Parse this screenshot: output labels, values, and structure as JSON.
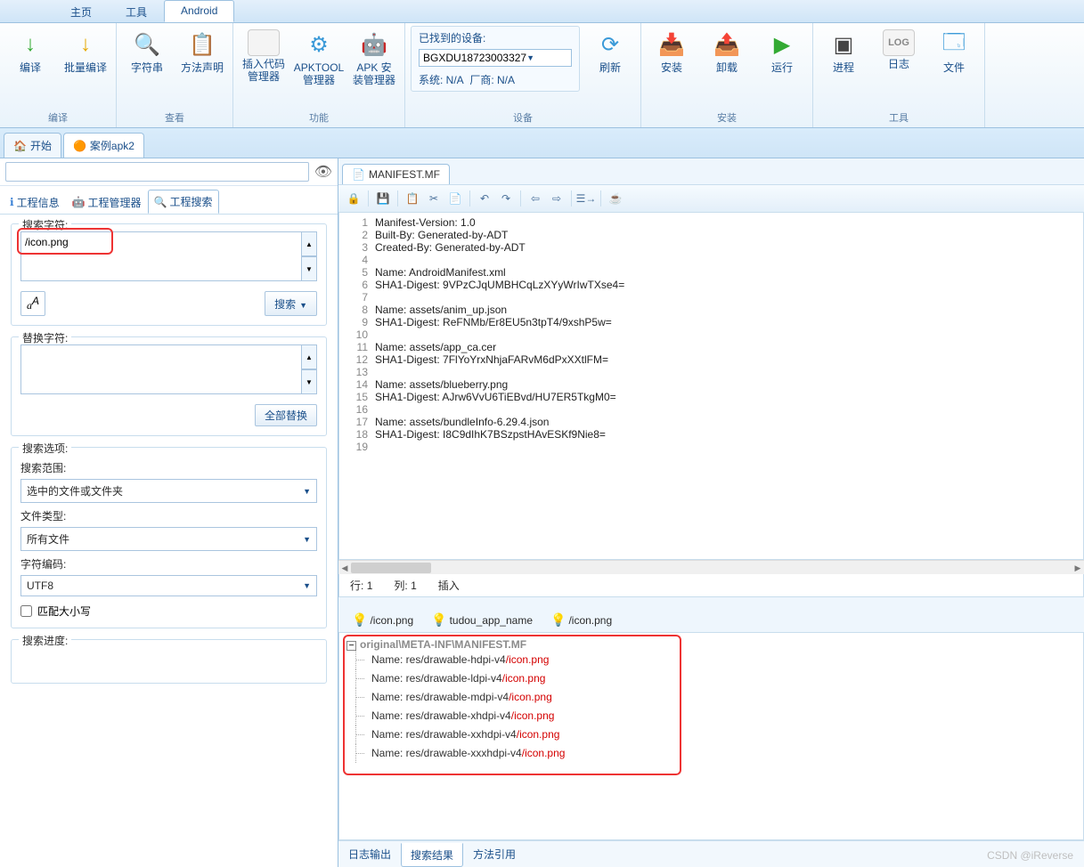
{
  "top_tabs": {
    "items": [
      "主页",
      "工具",
      "Android"
    ],
    "active": 2
  },
  "ribbon": {
    "groups": [
      {
        "label": "编译",
        "buttons": [
          {
            "name": "compile",
            "label": "编译",
            "icon": "↓",
            "color": "#33aa33"
          },
          {
            "name": "batch-compile",
            "label": "批量编译",
            "icon": "↓",
            "color": "#e7a900"
          }
        ]
      },
      {
        "label": "查看",
        "buttons": [
          {
            "name": "strings",
            "label": "字符串",
            "icon": "🔍",
            "color": "#4a8"
          },
          {
            "name": "method-decl",
            "label": "方法声明",
            "icon": "📋",
            "color": "#59a"
          }
        ]
      },
      {
        "label": "功能",
        "buttons": [
          {
            "name": "insert-code",
            "label": "插入代码管理器",
            "icon": "</>",
            "color": "#59a"
          },
          {
            "name": "apktool",
            "label": "APKTOOL管理器",
            "icon": "⚙",
            "color": "#3b9ad8"
          },
          {
            "name": "apk-install",
            "label": "APK 安装管理器",
            "icon": "🤖",
            "color": "#7bbd3f"
          }
        ]
      },
      {
        "label": "设备",
        "device": {
          "title": "已找到的设备:",
          "selected": "BGXDU18723003327",
          "info_sys": "系统: N/A",
          "info_vendor": "厂商: N/A"
        },
        "buttons": [
          {
            "name": "refresh",
            "label": "刷新",
            "icon": "⟳",
            "color": "#3b9ad8"
          }
        ]
      },
      {
        "label": "安装",
        "buttons": [
          {
            "name": "install",
            "label": "安装",
            "icon": "📥",
            "color": "#e7a900"
          },
          {
            "name": "uninstall",
            "label": "卸载",
            "icon": "📤",
            "color": "#e76f00"
          },
          {
            "name": "run",
            "label": "运行",
            "icon": "▶",
            "color": "#33aa33"
          }
        ]
      },
      {
        "label": "工具",
        "buttons": [
          {
            "name": "process",
            "label": "进程",
            "icon": "▣",
            "color": "#444"
          },
          {
            "name": "log",
            "label": "日志",
            "icon": "LOG",
            "color": "#888"
          },
          {
            "name": "file",
            "label": "文件",
            "icon": "🗔",
            "color": "#3b9ad8"
          }
        ]
      }
    ]
  },
  "ws_tabs": {
    "items": [
      {
        "name": "start",
        "label": "开始",
        "icon": "🏠"
      },
      {
        "name": "case-apk2",
        "label": "案例apk2",
        "icon": "🟠"
      }
    ],
    "active": 1
  },
  "side_tabs": {
    "items": [
      {
        "name": "proj-info",
        "label": "工程信息",
        "icon": "ℹ"
      },
      {
        "name": "proj-mgr",
        "label": "工程管理器",
        "icon": "🤖"
      },
      {
        "name": "proj-search",
        "label": "工程搜索",
        "icon": "🔍"
      }
    ],
    "active": 2
  },
  "search_panel": {
    "search_chars_label": "搜索字符:",
    "search_value": "/icon.png",
    "search_btn": "搜索",
    "replace_chars_label": "替换字符:",
    "replace_value": "",
    "replace_all_btn": "全部替换",
    "options_label": "搜索选项:",
    "scope_label": "搜索范围:",
    "scope_value": "选中的文件或文件夹",
    "filetype_label": "文件类型:",
    "filetype_value": "所有文件",
    "encoding_label": "字符编码:",
    "encoding_value": "UTF8",
    "match_case_label": "匹配大小写",
    "progress_label": "搜索进度:"
  },
  "editor": {
    "file_tab": "MANIFEST.MF",
    "lines": [
      "Manifest-Version: 1.0",
      "Built-By: Generated-by-ADT",
      "Created-By: Generated-by-ADT",
      "",
      "Name: AndroidManifest.xml",
      "SHA1-Digest: 9VPzCJqUMBHCqLzXYyWrIwTXse4=",
      "",
      "Name: assets/anim_up.json",
      "SHA1-Digest: ReFNMb/Er8EU5n3tpT4/9xshP5w=",
      "",
      "Name: assets/app_ca.cer",
      "SHA1-Digest: 7FlYoYrxNhjaFARvM6dPxXXtlFM=",
      "",
      "Name: assets/blueberry.png",
      "SHA1-Digest: AJrw6VvU6TiEBvd/HU7ER5TkgM0=",
      "",
      "Name: assets/bundleInfo-6.29.4.json",
      "SHA1-Digest: I8C9dIhK7BSzpstHAvESKf9Nie8=",
      ""
    ],
    "status": {
      "row_label": "行:",
      "row": "1",
      "col_label": "列:",
      "col": "1",
      "mode": "插入"
    }
  },
  "results": {
    "hints": [
      "/icon.png",
      "tudou_app_name",
      "/icon.png"
    ],
    "root": "original\\META-INF\\MANIFEST.MF",
    "items": [
      {
        "prefix": "Name: res/drawable-hdpi-v4",
        "match": "/icon.png"
      },
      {
        "prefix": "Name: res/drawable-ldpi-v4",
        "match": "/icon.png"
      },
      {
        "prefix": "Name: res/drawable-mdpi-v4",
        "match": "/icon.png"
      },
      {
        "prefix": "Name: res/drawable-xhdpi-v4",
        "match": "/icon.png"
      },
      {
        "prefix": "Name: res/drawable-xxhdpi-v4",
        "match": "/icon.png"
      },
      {
        "prefix": "Name: res/drawable-xxxhdpi-v4",
        "match": "/icon.png"
      }
    ]
  },
  "bottom_tabs": {
    "items": [
      "日志输出",
      "搜索结果",
      "方法引用"
    ],
    "active": 1
  },
  "watermark": "CSDN @iReverse"
}
